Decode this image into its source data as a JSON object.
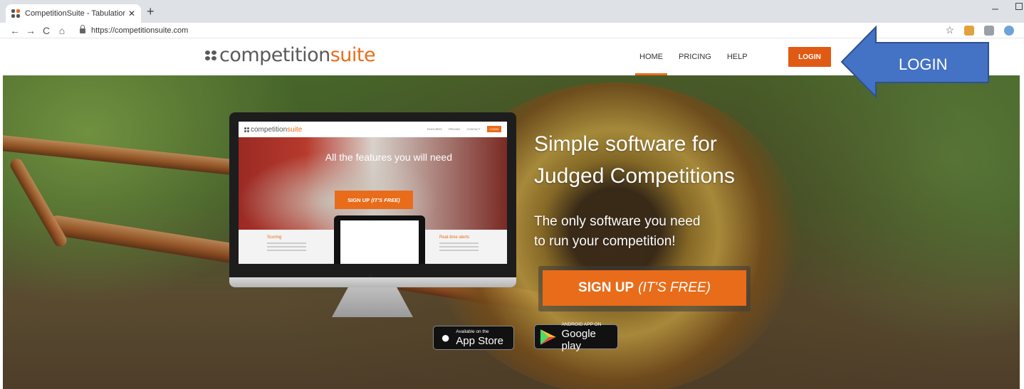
{
  "browser": {
    "tab_title": "CompetitionSuite - Tabulation/Sc",
    "tab_close": "✕",
    "new_tab": "+",
    "url": "https://competitionsuite.com",
    "back": "←",
    "forward": "→",
    "reload": "C",
    "home": "⌂",
    "star": "☆",
    "minimize": "–"
  },
  "site": {
    "logo_text": "competition",
    "logo_accent": "suite",
    "nav": {
      "home": "HOME",
      "pricing": "PRICING",
      "help": "HELP",
      "login": "LOGIN"
    },
    "annotation_label": "LOGIN",
    "accent_color": "#e86c1a"
  },
  "hero": {
    "headline_line1": "Simple software for",
    "headline_line2": "Judged Competitions",
    "subline_line1": "The only software you need",
    "subline_line2": "to run your competition!",
    "cta_main": "SIGN UP",
    "cta_em": "(IT'S FREE)",
    "monitor": {
      "logo_text": "competition",
      "logo_accent": "suite",
      "nav": [
        "FEATURES",
        "PRICING",
        "CONTACT",
        "LOGIN"
      ],
      "title": "All the features you will need",
      "signup_main": "SIGN UP",
      "signup_em": "(IT'S FREE)",
      "left_feature": "Scoring",
      "right_feature": "Real-time alerts"
    },
    "app_store": {
      "small": "Available on the",
      "big": "App Store"
    },
    "google_play": {
      "small": "ANDROID APP ON",
      "big": "Google play"
    }
  }
}
